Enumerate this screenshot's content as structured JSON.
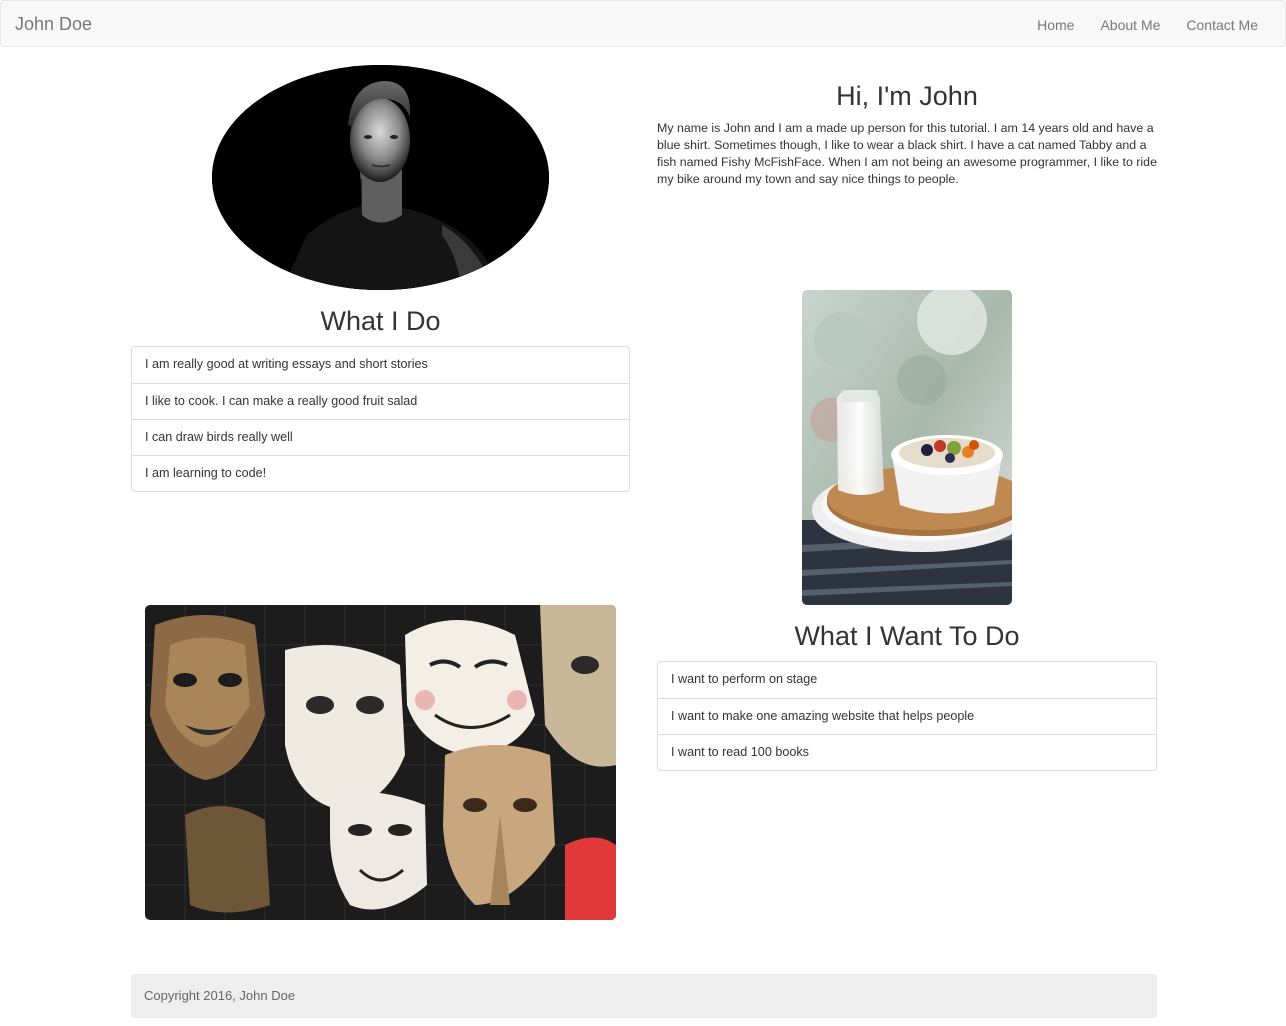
{
  "navbar": {
    "brand": "John Doe",
    "links": [
      "Home",
      "About Me",
      "Contact Me"
    ]
  },
  "hero": {
    "title": "Hi, I'm John",
    "text": "My name is John and I am a made up person for this tutorial. I am 14 years old and have a blue shirt. Sometimes though, I like to wear a black shirt. I have a cat named Tabby and a fish named Fishy McFishFace. When I am not being an awesome programmer, I like to ride my bike around my town and say nice things to people."
  },
  "what_i_do": {
    "title": "What I Do",
    "items": [
      "I am really good at writing essays and short stories",
      "I like to cook. I can make a really good fruit salad",
      "I can draw birds really well",
      "I am learning to code!"
    ]
  },
  "what_i_want": {
    "title": "What I Want To Do",
    "items": [
      "I want to perform on stage",
      "I want to make one amazing website that helps people",
      "I want to read 100 books"
    ]
  },
  "footer": {
    "text": "Copyright 2016, John Doe"
  },
  "colors": {
    "navbar_bg": "#f8f8f8",
    "nav_text": "#777777",
    "text": "#333333",
    "border": "#dddddd",
    "footer_bg": "#eeeeee"
  }
}
